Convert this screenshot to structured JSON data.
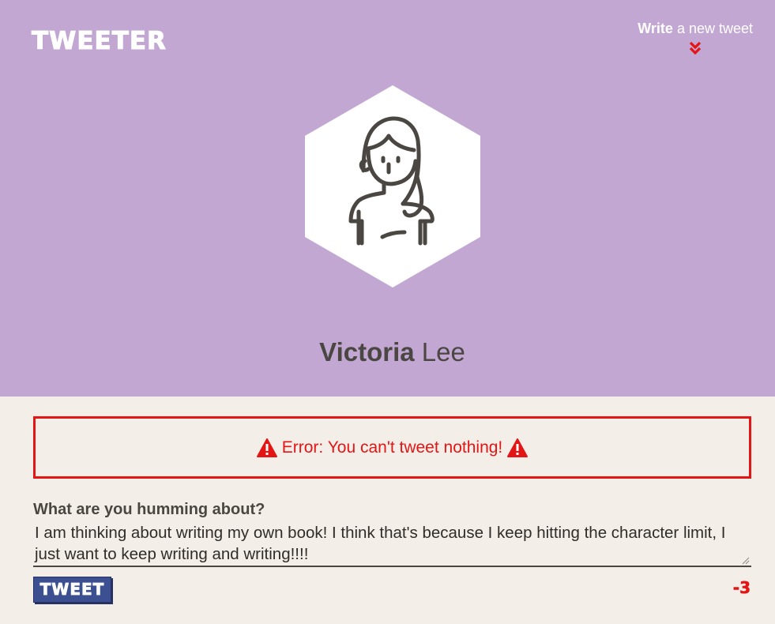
{
  "header": {
    "brand": "TWEETER",
    "write_strong": "Write",
    "write_rest": " a new tweet",
    "chevron_icon": "double-chevron-down-icon",
    "background_color": "#c1a7d2"
  },
  "profile": {
    "first_name": "Victoria",
    "last_name": " Lee",
    "avatar_icon": "woman-avatar-icon"
  },
  "error": {
    "message": "Error: You can't tweet nothing!",
    "icon": "warning-triangle-icon",
    "color": "#e31515"
  },
  "compose": {
    "question": "What are you humming about?",
    "value": "I am thinking about writing my own book! I think that's because I keep hitting the character limit, I just want to keep writing and writing!!!!",
    "button_label": "TWEET",
    "counter": "-3",
    "button_color": "#3c4f90"
  }
}
